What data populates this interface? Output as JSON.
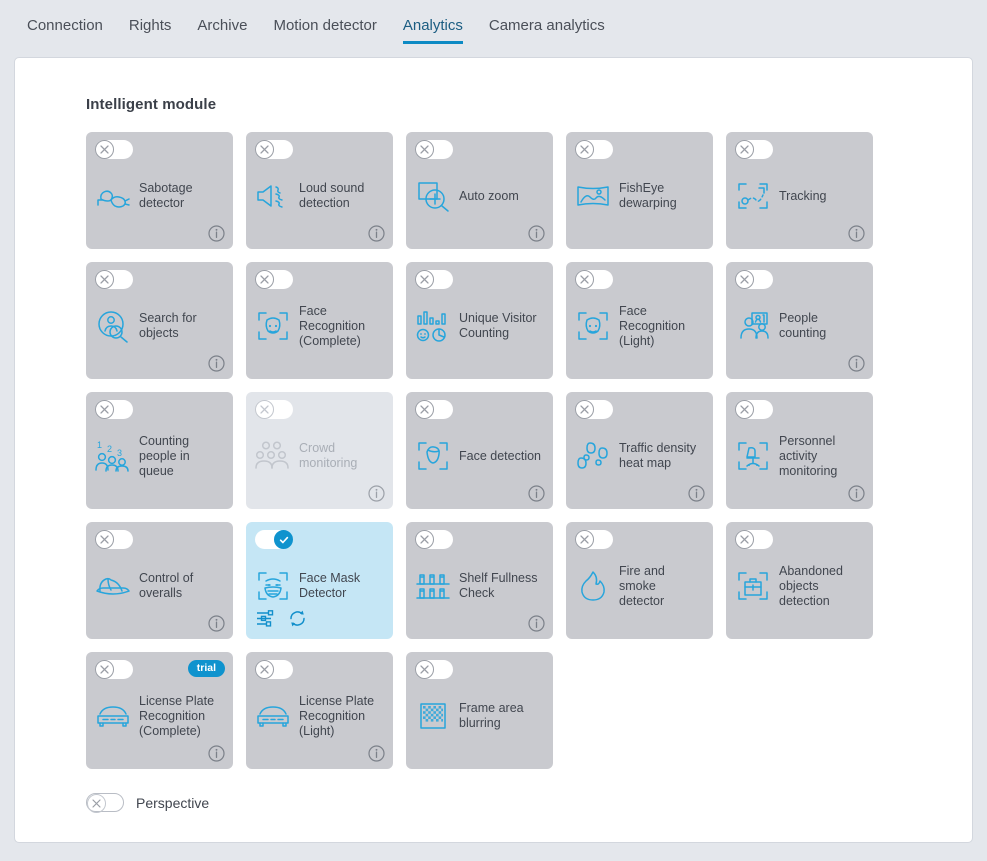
{
  "colors": {
    "accent": "#0c8ac4",
    "icon_blue": "#27a5dc",
    "card_gray": "#c9cacf",
    "card_active": "#c5e6f5",
    "card_disabled": "#e2e5ea",
    "page_bg": "#e4e7ec",
    "panel_bg": "#ffffff",
    "text": "#41464f"
  },
  "tabs": [
    {
      "label": "Connection",
      "active": false
    },
    {
      "label": "Rights",
      "active": false
    },
    {
      "label": "Archive",
      "active": false
    },
    {
      "label": "Motion detector",
      "active": false
    },
    {
      "label": "Analytics",
      "active": true
    },
    {
      "label": "Camera analytics",
      "active": false
    }
  ],
  "section": {
    "title": "Intelligent module"
  },
  "modules": [
    {
      "label": "Sabotage detector",
      "icon": "sabotage-detector-icon",
      "enabled": false,
      "state": "normal",
      "info": true,
      "badge": null,
      "actions": []
    },
    {
      "label": "Loud sound detection",
      "icon": "loud-sound-icon",
      "enabled": false,
      "state": "normal",
      "info": true,
      "badge": null,
      "actions": []
    },
    {
      "label": "Auto zoom",
      "icon": "auto-zoom-icon",
      "enabled": false,
      "state": "normal",
      "info": true,
      "badge": null,
      "actions": []
    },
    {
      "label": "FishEye dewarping",
      "icon": "fisheye-dewarping-icon",
      "enabled": false,
      "state": "normal",
      "info": false,
      "badge": null,
      "actions": []
    },
    {
      "label": "Tracking",
      "icon": "tracking-icon",
      "enabled": false,
      "state": "normal",
      "info": true,
      "badge": null,
      "actions": []
    },
    {
      "label": "Search for objects",
      "icon": "search-objects-icon",
      "enabled": false,
      "state": "normal",
      "info": true,
      "badge": null,
      "actions": []
    },
    {
      "label": "Face Recognition (Complete)",
      "icon": "face-recognition-icon",
      "enabled": false,
      "state": "normal",
      "info": false,
      "badge": null,
      "actions": []
    },
    {
      "label": "Unique Visitor Counting",
      "icon": "unique-visitor-icon",
      "enabled": false,
      "state": "normal",
      "info": false,
      "badge": null,
      "actions": []
    },
    {
      "label": "Face Recognition (Light)",
      "icon": "face-recognition-icon",
      "enabled": false,
      "state": "normal",
      "info": false,
      "badge": null,
      "actions": []
    },
    {
      "label": "People counting",
      "icon": "people-counting-icon",
      "enabled": false,
      "state": "normal",
      "info": true,
      "badge": null,
      "actions": []
    },
    {
      "label": "Counting people in queue",
      "icon": "queue-counting-icon",
      "enabled": false,
      "state": "normal",
      "info": false,
      "badge": null,
      "actions": []
    },
    {
      "label": "Crowd monitoring",
      "icon": "crowd-monitoring-icon",
      "enabled": false,
      "state": "disabled",
      "info": true,
      "badge": null,
      "actions": []
    },
    {
      "label": "Face detection",
      "icon": "face-detection-icon",
      "enabled": false,
      "state": "normal",
      "info": true,
      "badge": null,
      "actions": []
    },
    {
      "label": "Traffic density heat map",
      "icon": "footsteps-icon",
      "enabled": false,
      "state": "normal",
      "info": true,
      "badge": null,
      "actions": []
    },
    {
      "label": "Personnel activity monitoring",
      "icon": "personnel-activity-icon",
      "enabled": false,
      "state": "normal",
      "info": true,
      "badge": null,
      "actions": []
    },
    {
      "label": "Control of overalls",
      "icon": "hard-hat-icon",
      "enabled": false,
      "state": "normal",
      "info": true,
      "badge": null,
      "actions": []
    },
    {
      "label": "Face Mask Detector",
      "icon": "face-mask-icon",
      "enabled": true,
      "state": "active",
      "info": false,
      "badge": null,
      "actions": [
        "settings-sliders-icon",
        "refresh-icon"
      ]
    },
    {
      "label": "Shelf Fullness Check",
      "icon": "shelf-fullness-icon",
      "enabled": false,
      "state": "normal",
      "info": true,
      "badge": null,
      "actions": []
    },
    {
      "label": "Fire and smoke detector",
      "icon": "flame-icon",
      "enabled": false,
      "state": "normal",
      "info": false,
      "badge": null,
      "actions": []
    },
    {
      "label": "Abandoned objects detection",
      "icon": "abandoned-object-icon",
      "enabled": false,
      "state": "normal",
      "info": false,
      "badge": null,
      "actions": []
    },
    {
      "label": "License Plate Recognition (Complete)",
      "icon": "license-plate-icon",
      "enabled": false,
      "state": "normal",
      "info": true,
      "badge": "trial",
      "actions": []
    },
    {
      "label": "License Plate Recognition (Light)",
      "icon": "license-plate-icon",
      "enabled": false,
      "state": "normal",
      "info": true,
      "badge": null,
      "actions": []
    },
    {
      "label": "Frame area blurring",
      "icon": "frame-blur-icon",
      "enabled": false,
      "state": "normal",
      "info": false,
      "badge": null,
      "actions": []
    }
  ],
  "perspective": {
    "label": "Perspective",
    "enabled": false
  }
}
